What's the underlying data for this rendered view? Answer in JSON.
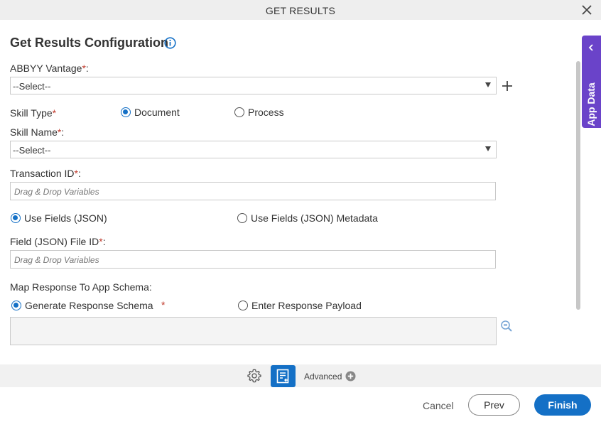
{
  "window": {
    "title": "GET RESULTS"
  },
  "form": {
    "heading": "Get Results Configuration",
    "abbyy_vantage": {
      "label": "ABBYY Vantage",
      "required_mark": "*",
      "colon": ":",
      "value": "--Select--"
    },
    "skill_type": {
      "label": "Skill Type",
      "required_mark": "*",
      "options": [
        "Document",
        "Process"
      ],
      "selected": "Document"
    },
    "skill_name": {
      "label": "Skill Name",
      "required_mark": "*",
      "colon": ":",
      "value": "--Select--"
    },
    "transaction_id": {
      "label": "Transaction ID",
      "required_mark": "*",
      "colon": ":",
      "placeholder": "Drag & Drop Variables"
    },
    "fields_mode": {
      "options": [
        "Use Fields (JSON)",
        "Use Fields (JSON) Metadata"
      ],
      "selected": "Use Fields (JSON)"
    },
    "field_file_id": {
      "label": "Field (JSON) File ID",
      "required_mark": "*",
      "colon": ":",
      "placeholder": "Drag & Drop Variables"
    },
    "map_response": {
      "label": "Map Response To App Schema:",
      "options": [
        "Generate Response Schema",
        "Enter Response Payload"
      ],
      "required_mark": "*",
      "selected": "Generate Response Schema"
    }
  },
  "side_panel": {
    "label": "App Data"
  },
  "toolbar": {
    "advanced_label": "Advanced"
  },
  "footer": {
    "cancel_label": "Cancel",
    "prev_label": "Prev",
    "finish_label": "Finish"
  },
  "colors": {
    "accent": "#1470c6",
    "side_panel": "#6a43c9",
    "required": "#c0392b"
  }
}
